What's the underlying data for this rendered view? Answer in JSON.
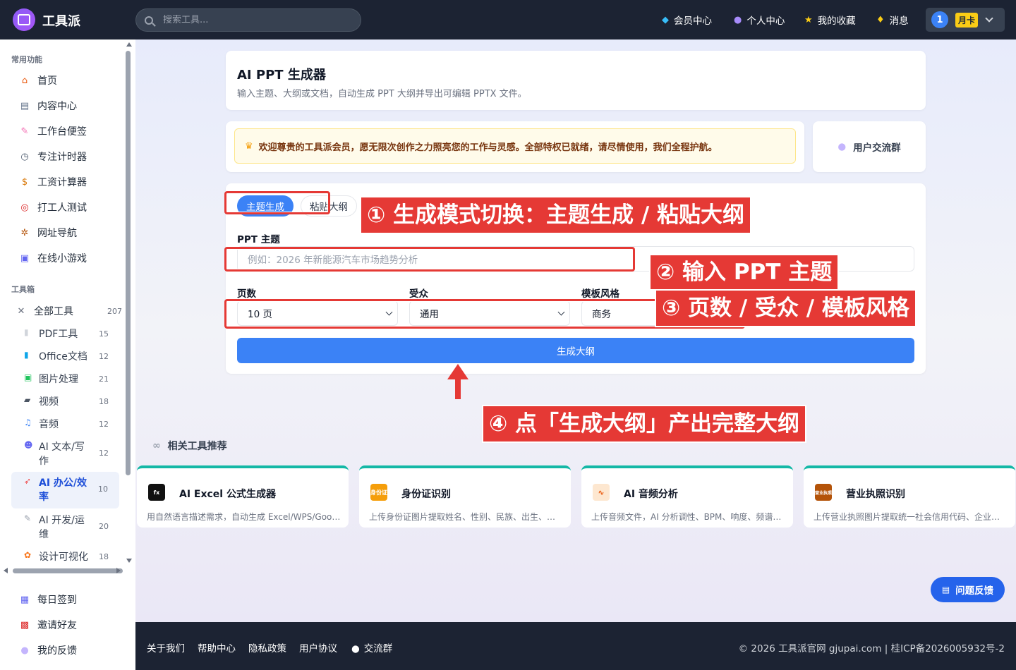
{
  "brand": {
    "name": "工具派"
  },
  "search": {
    "placeholder": "搜索工具..."
  },
  "topnav": {
    "items": [
      {
        "icon": "diamond-icon",
        "label": "会员中心"
      },
      {
        "icon": "person-icon",
        "label": "个人中心"
      },
      {
        "icon": "star-icon",
        "label": "我的收藏"
      },
      {
        "icon": "bell-icon",
        "label": "消息"
      }
    ],
    "user": {
      "avatar": "1",
      "plan": "月卡"
    }
  },
  "sidebar": {
    "section_common": "常用功能",
    "common": [
      {
        "icon": "house-icon",
        "label": "首页"
      },
      {
        "icon": "content-icon",
        "label": "内容中心"
      },
      {
        "icon": "memo-icon",
        "label": "工作台便签"
      },
      {
        "icon": "timer-icon",
        "label": "专注计时器"
      },
      {
        "icon": "moneybag-icon",
        "label": "工资计算器"
      },
      {
        "icon": "target-icon",
        "label": "打工人测试"
      },
      {
        "icon": "compass-icon",
        "label": "网址导航"
      },
      {
        "icon": "gamepad-icon",
        "label": "在线小游戏"
      }
    ],
    "section_tools": "工具箱",
    "all_tools": {
      "icon": "tools-icon",
      "label": "全部工具",
      "count": "207"
    },
    "tools": [
      {
        "icon": "pdf-icon",
        "label": "PDF工具",
        "count": "15"
      },
      {
        "icon": "office-icon",
        "label": "Office文档",
        "count": "12"
      },
      {
        "icon": "image-icon",
        "label": "图片处理",
        "count": "21"
      },
      {
        "icon": "clapper-icon",
        "label": "视频",
        "count": "18"
      },
      {
        "icon": "music-icon",
        "label": "音频",
        "count": "12"
      },
      {
        "icon": "robot-icon",
        "label": "AI 文本/写作",
        "count": "12"
      },
      {
        "icon": "rocket-icon",
        "label": "AI 办公/效率",
        "count": "10",
        "active": true
      },
      {
        "icon": "wrench-icon",
        "label": "AI 开发/运维",
        "count": "20"
      },
      {
        "icon": "palette-icon",
        "label": "设计可视化",
        "count": "18"
      }
    ],
    "bottom": [
      {
        "icon": "calendar-icon",
        "label": "每日签到"
      },
      {
        "icon": "gift-icon",
        "label": "邀请好友"
      },
      {
        "icon": "chat-icon",
        "label": "我的反馈"
      }
    ]
  },
  "page": {
    "title": "AI PPT 生成器",
    "subtitle": "输入主题、大纲或文档，自动生成 PPT 大纲并导出可编辑 PPTX 文件。",
    "welcome": "欢迎尊贵的工具派会员，愿无限次创作之力照亮您的工作与灵感。全部特权已就绪，请尽情使用，我们全程护航。",
    "group_button": "用户交流群"
  },
  "form": {
    "mode_tabs": [
      "主题生成",
      "粘贴大纲"
    ],
    "active_mode": "主题生成",
    "topic_label": "PPT 主题",
    "topic_placeholder": "例如：2026 年新能源汽车市场趋势分析",
    "pages_label": "页数",
    "pages_value": "10 页",
    "audience_label": "受众",
    "audience_value": "通用",
    "style_label": "模板风格",
    "style_value": "商务",
    "generate_button": "生成大纲"
  },
  "annotations": [
    "① 生成模式切换：主题生成 / 粘贴大纲",
    "② 输入 PPT 主题",
    "③ 页数 / 受众 / 模板风格",
    "④ 点「生成大纲」产出完整大纲"
  ],
  "related": {
    "title": "相关工具推荐",
    "tools": [
      {
        "icon": "fx-icon",
        "icon_text": "fx",
        "name": "AI Excel 公式生成器",
        "desc": "用自然语言描述需求，自动生成 Excel/WPS/Google Sheets 公式",
        "color": "#111111"
      },
      {
        "icon": "idcard-icon",
        "icon_text": "身份证",
        "name": "身份证识别",
        "desc": "上传身份证图片提取姓名、性别、民族、出生、住址等信息",
        "color": "#f59e0b"
      },
      {
        "icon": "audio-wave-icon",
        "icon_text": "",
        "name": "AI 音频分析",
        "desc": "上传音频文件，AI 分析调性、BPM、响度、频谱等特征",
        "color": "#fde7d0"
      },
      {
        "icon": "license-icon",
        "icon_text": "营业执照",
        "name": "营业执照识别",
        "desc": "上传营业执照图片提取统一社会信用代码、企业名称等信息",
        "color": "#b45309"
      }
    ]
  },
  "feedback_button": "问题反馈",
  "footer": {
    "links": [
      "关于我们",
      "帮助中心",
      "隐私政策",
      "用户协议",
      "交流群"
    ],
    "copyright": "© 2026 工具派官网 gjupai.com | 桂ICP备2026005932号-2"
  }
}
